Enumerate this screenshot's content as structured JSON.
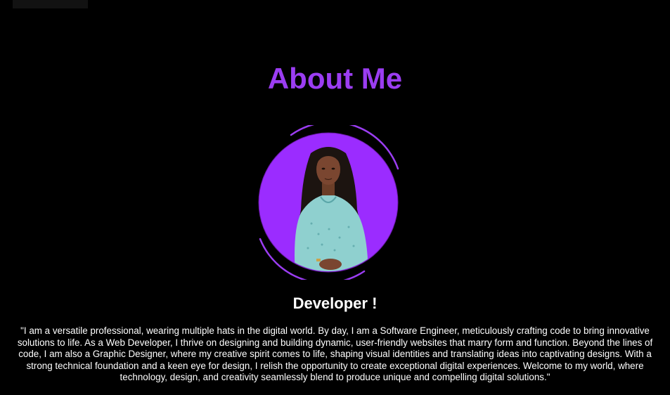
{
  "about": {
    "heading": "About Me",
    "role": "Developer !",
    "bio": "\"I am a versatile professional, wearing multiple hats in the digital world. By day, I am a Software Engineer, meticulously crafting code to bring innovative solutions to life. As a Web Developer, I thrive on designing and building dynamic, user-friendly websites that marry form and function. Beyond the lines of code, I am also a Graphic Designer, where my creative spirit comes to life, shaping visual identities and translating ideas into captivating designs. With a strong technical foundation and a keen eye for design, I relish the opportunity to create exceptional digital experiences. Welcome to my world, where technology, design, and creativity seamlessly blend to produce unique and compelling digital solutions.\""
  },
  "colors": {
    "accent": "#9b3df2",
    "avatar_bg": "#9b2cff",
    "background": "#000000",
    "text": "#ffffff"
  },
  "icons": {
    "profile_photo": "profile-photo-icon"
  }
}
